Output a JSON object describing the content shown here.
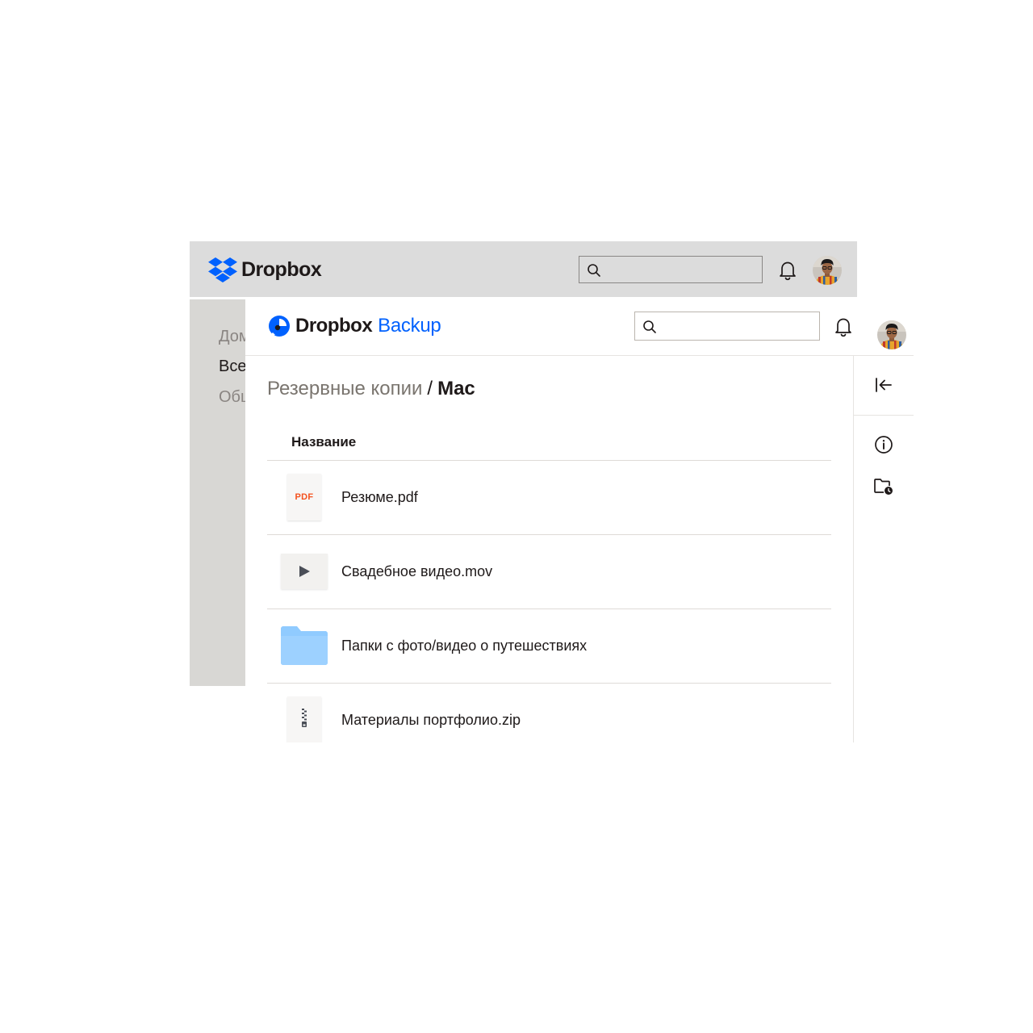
{
  "background_app": {
    "brand": "Dropbox",
    "search": {
      "placeholder": ""
    },
    "sidebar": {
      "items": [
        {
          "label": "Домашняя"
        },
        {
          "label": "Все файлы"
        },
        {
          "label": "Общий доступ"
        }
      ]
    }
  },
  "backup_app": {
    "brand": "Dropbox",
    "product": "Backup",
    "search": {
      "placeholder": ""
    },
    "breadcrumb": {
      "parent": "Резервные копии",
      "separator": "/",
      "current": "Mac"
    },
    "table": {
      "column_header": "Название",
      "rows": [
        {
          "name": "Резюме.pdf",
          "icon": "pdf-file-icon",
          "badge": "PDF"
        },
        {
          "name": "Свадебное видео.mov",
          "icon": "video-file-icon"
        },
        {
          "name": "Папки с фото/видео о путешествиях",
          "icon": "folder-icon"
        },
        {
          "name": "Материалы портфолио.zip",
          "icon": "zip-file-icon"
        }
      ]
    },
    "rail": [
      "collapse-panel-icon",
      "info-icon",
      "folder-history-icon"
    ]
  },
  "colors": {
    "dropbox_blue": "#0061fe",
    "pdf_red": "#f4511e",
    "folder_blue": "#90cbff",
    "header_gray": "#dcdcdc",
    "sidebar_gray": "#d8d7d4"
  }
}
